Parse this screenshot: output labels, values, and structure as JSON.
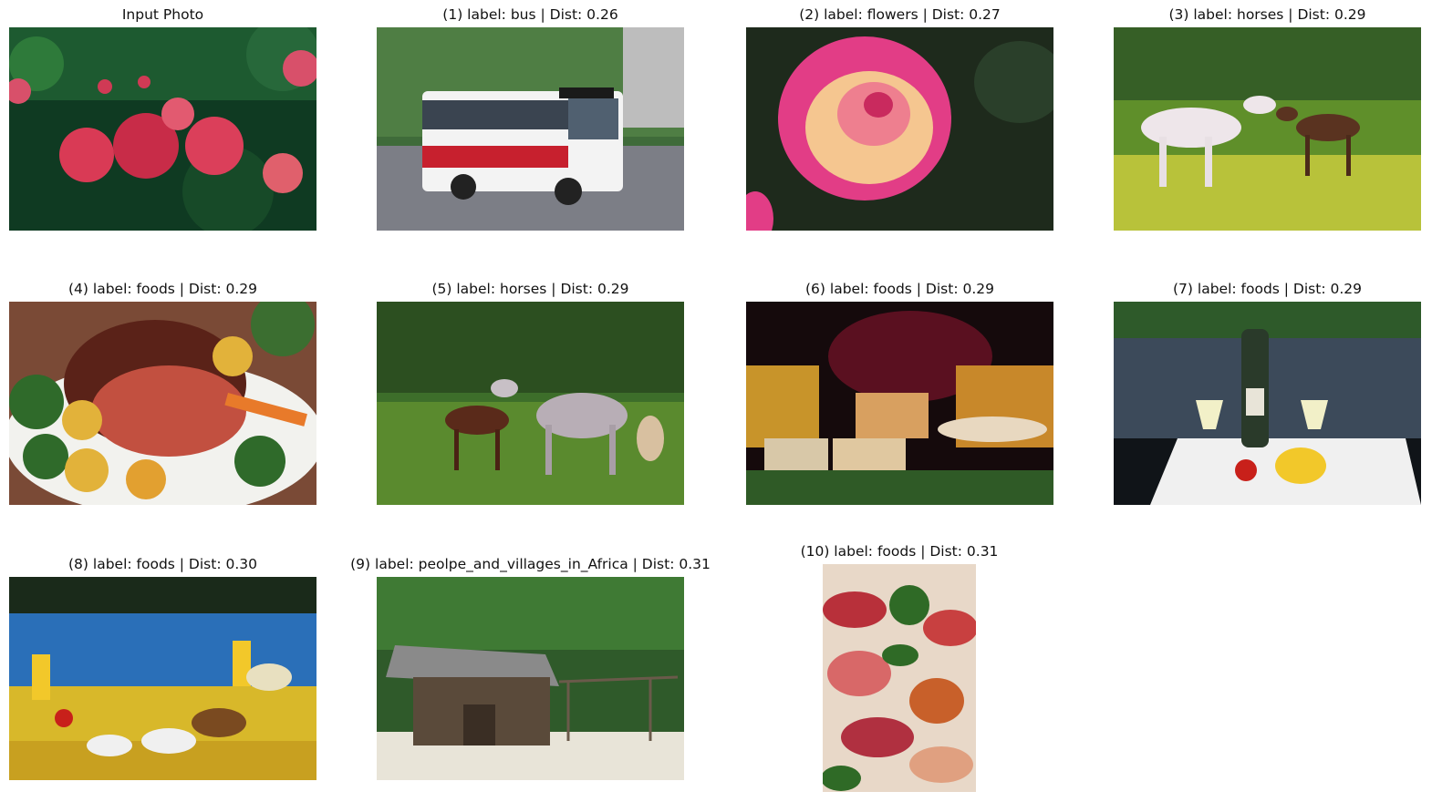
{
  "figure": {
    "panels": [
      {
        "title": "Input Photo",
        "image": "roses-photo"
      },
      {
        "title": "(1) label: bus | Dist: 0.26",
        "image": "bus-photo"
      },
      {
        "title": "(2) label: flowers | Dist: 0.27",
        "image": "rose-closeup-photo"
      },
      {
        "title": "(3) label: horses | Dist: 0.29",
        "image": "horse-and-foal-meadow-photo"
      },
      {
        "title": "(4) label: foods | Dist: 0.29",
        "image": "roast-beef-plate-photo"
      },
      {
        "title": "(5) label: horses | Dist: 0.29",
        "image": "horse-and-foal-running-photo"
      },
      {
        "title": "(6) label: foods | Dist: 0.29",
        "image": "sausages-and-pate-photo"
      },
      {
        "title": "(7) label: foods | Dist: 0.29",
        "image": "wine-cheese-river-photo"
      },
      {
        "title": "(8) label: foods | Dist: 0.30",
        "image": "poolside-buffet-photo"
      },
      {
        "title": "(9) label: peolpe_and_villages_in_Africa | Dist: 0.31",
        "image": "tin-hut-palms-photo"
      },
      {
        "title": "(10) label: foods | Dist: 0.31",
        "image": "cold-cuts-platter-photo"
      }
    ]
  }
}
